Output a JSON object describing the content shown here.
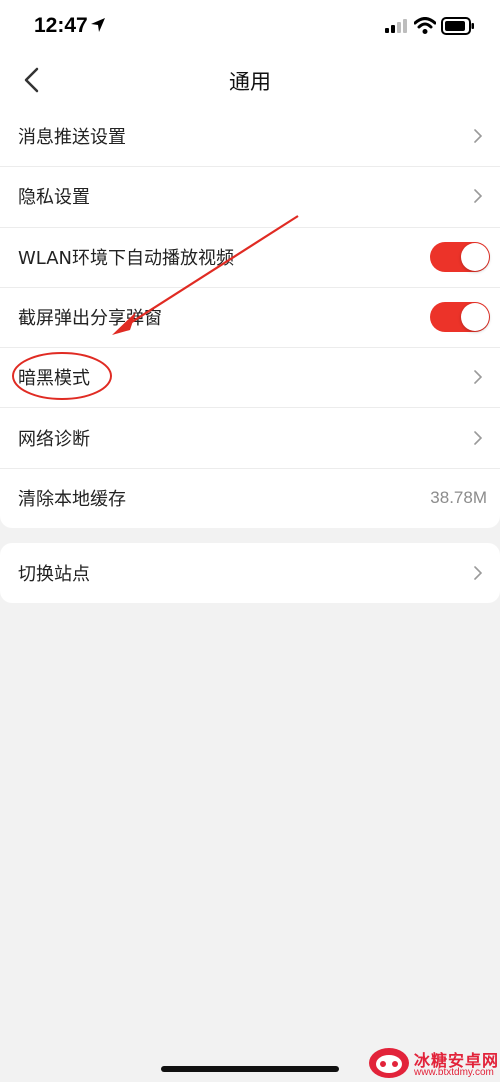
{
  "status_bar": {
    "time": "12:47"
  },
  "nav": {
    "title": "通用"
  },
  "settings": [
    {
      "label": "消息推送设置"
    },
    {
      "label": "隐私设置"
    },
    {
      "label": "WLAN环境下自动播放视频",
      "toggle": true
    },
    {
      "label": "截屏弹出分享弹窗",
      "toggle": true
    },
    {
      "label": "暗黑模式"
    },
    {
      "label": "网络诊断"
    },
    {
      "label": "清除本地缓存",
      "value": "38.78M"
    }
  ],
  "secondary": [
    {
      "label": "切换站点"
    }
  ],
  "colors": {
    "accent": "#ec3329",
    "background": "#f2f2f2",
    "annotation": "#e02b23"
  },
  "watermark": {
    "title": "冰糖安卓网",
    "url": "www.btxtdmy.com"
  }
}
